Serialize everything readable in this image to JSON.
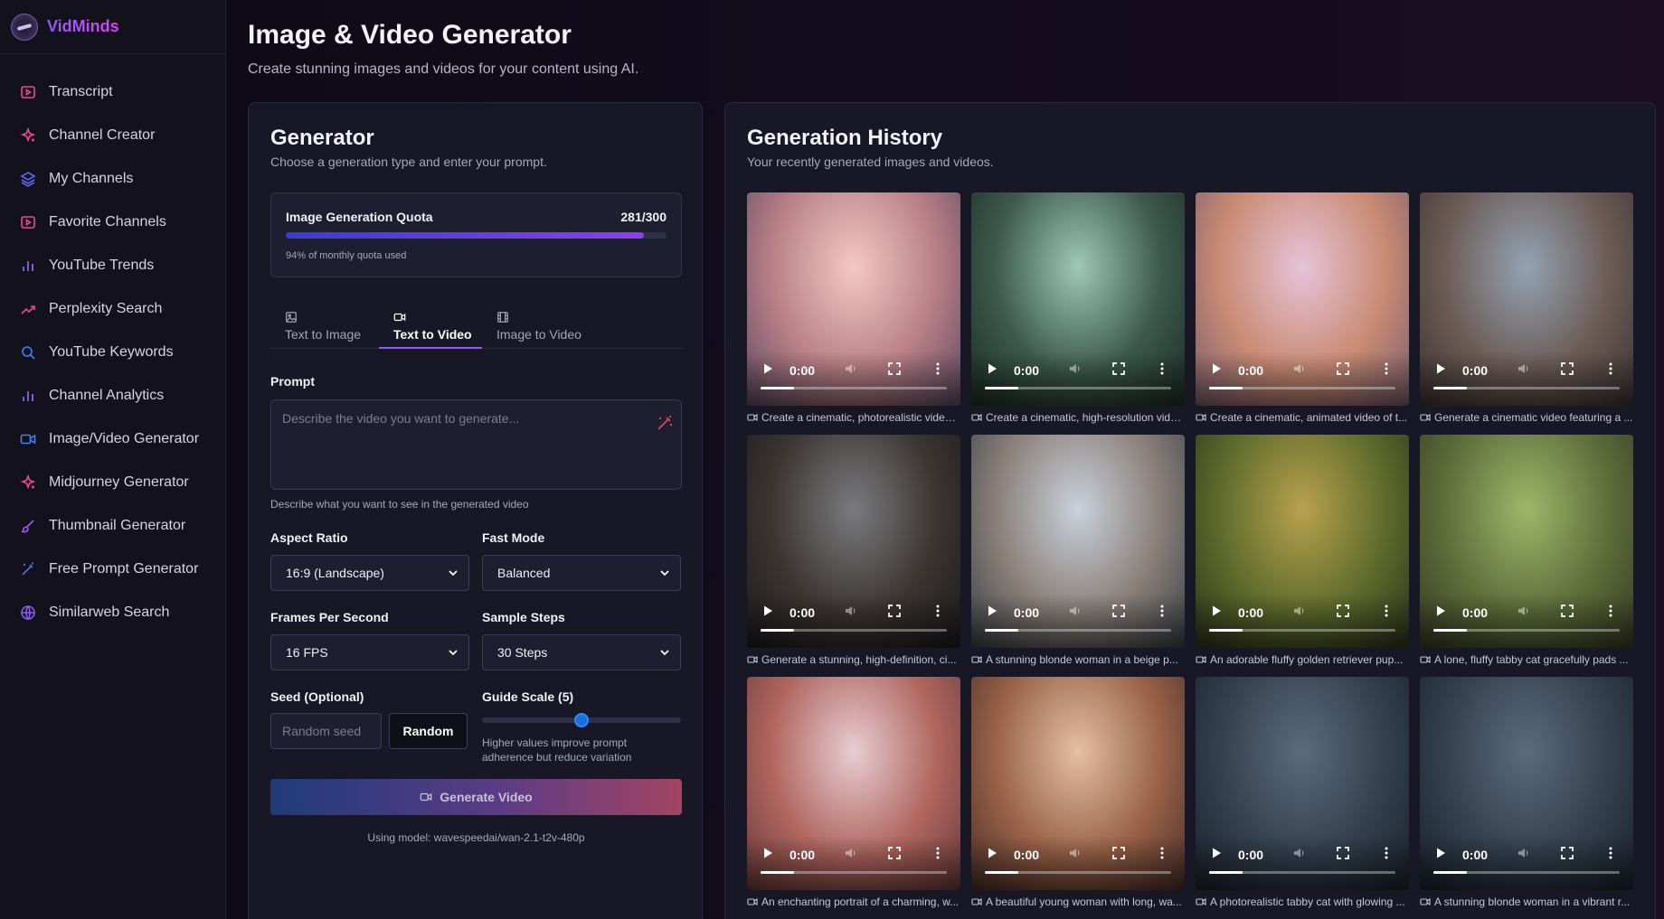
{
  "brand": {
    "name": "VidMinds"
  },
  "sidebar": {
    "items": [
      {
        "label": "Transcript",
        "icon": "play-square-icon"
      },
      {
        "label": "Channel Creator",
        "icon": "sparkle-icon"
      },
      {
        "label": "My Channels",
        "icon": "layers-icon"
      },
      {
        "label": "Favorite Channels",
        "icon": "play-square-icon"
      },
      {
        "label": "YouTube Trends",
        "icon": "bar-chart-icon"
      },
      {
        "label": "Perplexity Search",
        "icon": "trending-up-icon"
      },
      {
        "label": "YouTube Keywords",
        "icon": "search-icon"
      },
      {
        "label": "Channel Analytics",
        "icon": "bar-chart-icon"
      },
      {
        "label": "Image/Video Generator",
        "icon": "video-camera-icon"
      },
      {
        "label": "Midjourney Generator",
        "icon": "sparkle-icon"
      },
      {
        "label": "Thumbnail Generator",
        "icon": "brush-icon"
      },
      {
        "label": "Free Prompt Generator",
        "icon": "wand-icon"
      },
      {
        "label": "Similarweb Search",
        "icon": "globe-icon"
      }
    ],
    "accent_colors": {
      "purple": "#8b5cf6",
      "pink": "#ec4899",
      "blue": "#3b82f6"
    }
  },
  "header": {
    "title": "Image & Video Generator",
    "subtitle": "Create stunning images and videos for your content using AI."
  },
  "generator": {
    "title": "Generator",
    "subtitle": "Choose a generation type and enter your prompt.",
    "quota": {
      "label": "Image Generation Quota",
      "count": "281/300",
      "used_fraction": 0.94,
      "note": "94% of monthly quota used"
    },
    "tabs": [
      {
        "label": "Text to Image",
        "icon": "image-icon",
        "active": false
      },
      {
        "label": "Text to Video",
        "icon": "video-camera-icon",
        "active": true
      },
      {
        "label": "Image to Video",
        "icon": "film-icon",
        "active": false
      }
    ],
    "prompt": {
      "label": "Prompt",
      "placeholder": "Describe the video you want to generate...",
      "value": "",
      "hint": "Describe what you want to see in the generated video"
    },
    "aspect_ratio": {
      "label": "Aspect Ratio",
      "value": "16:9 (Landscape)"
    },
    "fast_mode": {
      "label": "Fast Mode",
      "value": "Balanced"
    },
    "fps": {
      "label": "Frames Per Second",
      "value": "16 FPS"
    },
    "sample_steps": {
      "label": "Sample Steps",
      "value": "30 Steps"
    },
    "seed": {
      "label": "Seed (Optional)",
      "placeholder": "Random seed",
      "value": "",
      "random_label": "Random"
    },
    "guide_scale": {
      "label": "Guide Scale (5)",
      "value_fraction": 0.5,
      "hint_line1": "Higher values improve prompt",
      "hint_line2": "adherence but reduce variation"
    },
    "generate_button": "Generate Video",
    "model_note": "Using model: wavespeedai/wan-2.1-t2v-480p"
  },
  "history": {
    "title": "Generation History",
    "subtitle": "Your recently generated images and videos.",
    "time_label": "0:00",
    "items": [
      {
        "caption": "Create a cinematic, photorealistic video ...",
        "colors": [
          "#f3c9c2",
          "#b97f86",
          "#5d4a63"
        ]
      },
      {
        "caption": "Create a cinematic, high-resolution vide...",
        "colors": [
          "#9fc7b8",
          "#3c5a4c",
          "#1d2b25"
        ]
      },
      {
        "caption": "Create a cinematic, animated video of t...",
        "colors": [
          "#e7c3d9",
          "#c98b73",
          "#7a5d6e"
        ]
      },
      {
        "caption": "Generate a cinematic video featuring a ...",
        "colors": [
          "#93a3b3",
          "#6c5b55",
          "#3c3432"
        ]
      },
      {
        "caption": "Generate a stunning, high-definition, ci...",
        "colors": [
          "#7a7b7e",
          "#3b3532",
          "#1b1a1c"
        ]
      },
      {
        "caption": "A stunning blonde woman in a beige p...",
        "colors": [
          "#c9d1dc",
          "#8a7f78",
          "#3a4048"
        ]
      },
      {
        "caption": "An adorable fluffy golden retriever pup...",
        "colors": [
          "#b8a24e",
          "#5f6b2c",
          "#2e331c"
        ]
      },
      {
        "caption": "A lone, fluffy tabby cat gracefully pads ...",
        "colors": [
          "#9fb66a",
          "#5d6e3a",
          "#3a3a22"
        ]
      },
      {
        "caption": "An enchanting portrait of a charming, w...",
        "colors": [
          "#e8cdd3",
          "#b0665f",
          "#6a3a3a"
        ]
      },
      {
        "caption": "A beautiful young woman with long, wa...",
        "colors": [
          "#e3c0a3",
          "#9a6248",
          "#4a2e2a"
        ]
      },
      {
        "caption": "A photorealistic tabby cat with glowing ...",
        "colors": [
          "#5b6b7d",
          "#33404e",
          "#1a222c"
        ]
      },
      {
        "caption": "A stunning blonde woman in a vibrant r...",
        "colors": [
          "#5b6b7d",
          "#33404e",
          "#1a222c"
        ]
      }
    ]
  }
}
